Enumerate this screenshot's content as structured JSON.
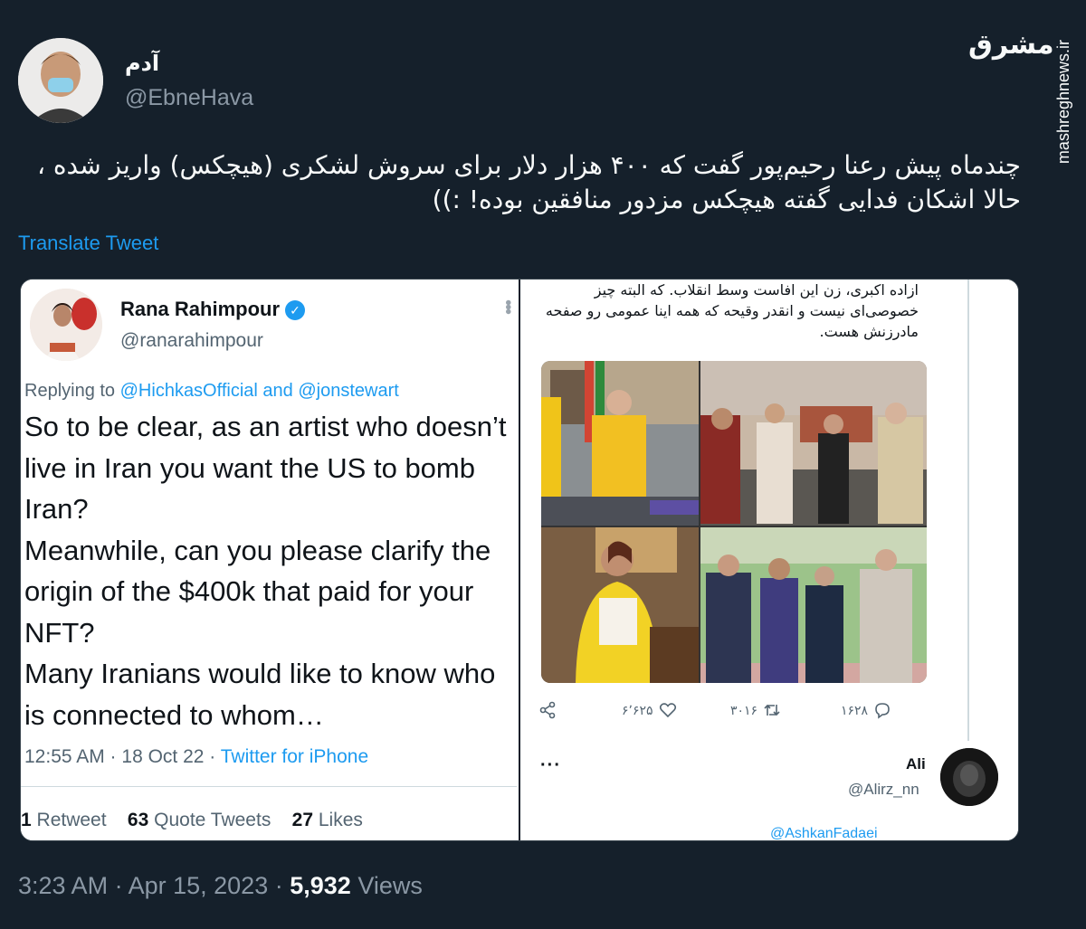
{
  "author": {
    "display_name": "آدم",
    "handle": "@EbneHava"
  },
  "watermark": {
    "logo": "مشرق",
    "url": "mashreghnews.ir"
  },
  "tweet": {
    "text": "چندماه پیش رعنا رحیم‌پور گفت که ۴۰۰ هزار دلار برای سروش لشکری (هیچکس) واریز شده ، حالا اشکان فدایی گفته هیچکس مزدور منافقین بوده! :))",
    "translate_label": "Translate Tweet",
    "footer": {
      "time": "3:23 AM",
      "date": "Apr 15, 2023",
      "views_count": "5,932",
      "views_label": "Views",
      "sep": "·"
    }
  },
  "quoted": {
    "name": "Rana Rahimpour",
    "handle": "@ranarahimpour",
    "replying_prefix": "Replying to",
    "mention1": "@HichkasOfficial",
    "and_word": "and",
    "mention2": "@jonstewart",
    "body": "So to be clear, as an artist who doesn’t live in Iran you want the US to bomb Iran?\nMeanwhile, can you please clarify the origin of the $400k that paid for your NFT?\nMany Iranians would like to know who is connected to whom…",
    "time": "12:55 AM · 18 Oct 22 · ",
    "source": "Twitter for iPhone",
    "retweets_count": "1",
    "retweets_label": "Retweet",
    "quotes_count": "63",
    "quotes_label": "Quote Tweets",
    "likes_count": "27",
    "likes_label": "Likes"
  },
  "right_shot": {
    "fa_text": "ازاده اکبری، زن این افاست وسط انقلاب. که البته چیز خصوصی‌ای نیست و انقدر وقیحه که همه اینا عمومی رو صفحه مادرزنش هست.",
    "replies": "۱۶۲۸",
    "retweets": "۳۰۱۶",
    "likes": "۶٬۶۲۵",
    "reply_author": "Ali",
    "reply_handle": "@Alirz_nn",
    "reply_mention": "@AshkanFadaei"
  }
}
